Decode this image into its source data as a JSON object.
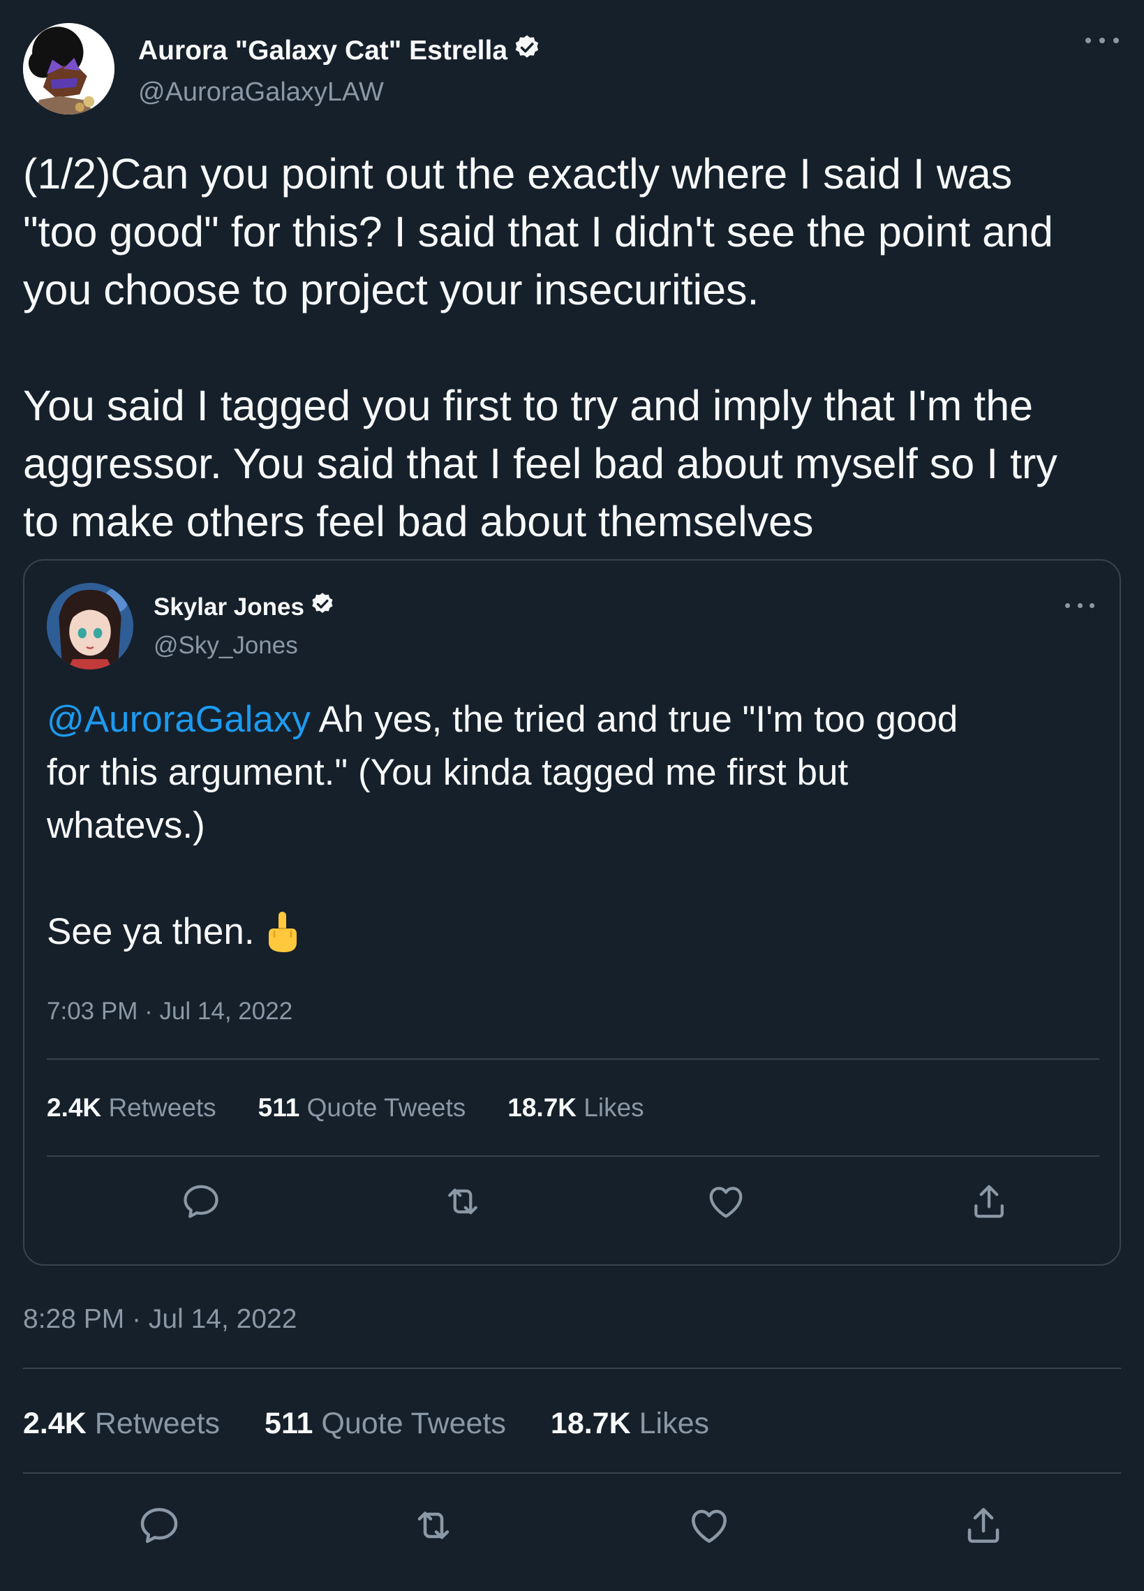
{
  "author": {
    "name": "Aurora \"Galaxy Cat\" Estrella",
    "handle": "@AuroraGalaxyLAW",
    "verified": true,
    "avatar_icon": "avatar-character"
  },
  "tweet": {
    "paragraph_1_lines": [
      "(1/2)Can you point out the exactly where I said I was",
      "\"too good\" for this? I said that I didn't see the point and",
      "you choose to project your insecurities."
    ],
    "paragraph_2_lines": [
      "You said I tagged you first to try and imply that I'm the",
      "aggressor. You said that I feel bad about myself so I try",
      "to make others feel bad about themselves"
    ],
    "timestamp": "8:28 PM · Jul 14, 2022",
    "stats": {
      "retweets_count": "2.4K",
      "retweets_label": "Retweets",
      "quotes_count": "511",
      "quotes_label": "Quote Tweets",
      "likes_count": "18.7K",
      "likes_label": "Likes"
    }
  },
  "quoted_tweet": {
    "name": "Skylar Jones",
    "handle": "@Sky_Jones",
    "verified": true,
    "mention": "@AuroraGalaxy",
    "line_1_rest": " Ah yes, the tried and true \"I'm too good",
    "line_2": "for this argument.\" (You kinda tagged me first but",
    "line_3": "whatevs.)",
    "line_4": "See ya then.",
    "emoji_icon": "middle-finger-emoji",
    "timestamp": "7:03 PM · Jul 14, 2022",
    "stats": {
      "retweets_count": "2.4K",
      "retweets_label": "Retweets",
      "quotes_count": "511",
      "quotes_label": "Quote Tweets",
      "likes_count": "18.7K",
      "likes_label": "Likes"
    }
  },
  "icons": {
    "more": "more-icon",
    "reply": "reply-icon",
    "retweet": "retweet-icon",
    "like": "heart-icon",
    "share": "share-icon",
    "verified": "verified-badge-icon"
  },
  "colors": {
    "background": "#15202b",
    "text": "#f7f9f9",
    "secondary": "#8b98a5",
    "border": "#38444d",
    "accent": "#1d9bf0"
  }
}
